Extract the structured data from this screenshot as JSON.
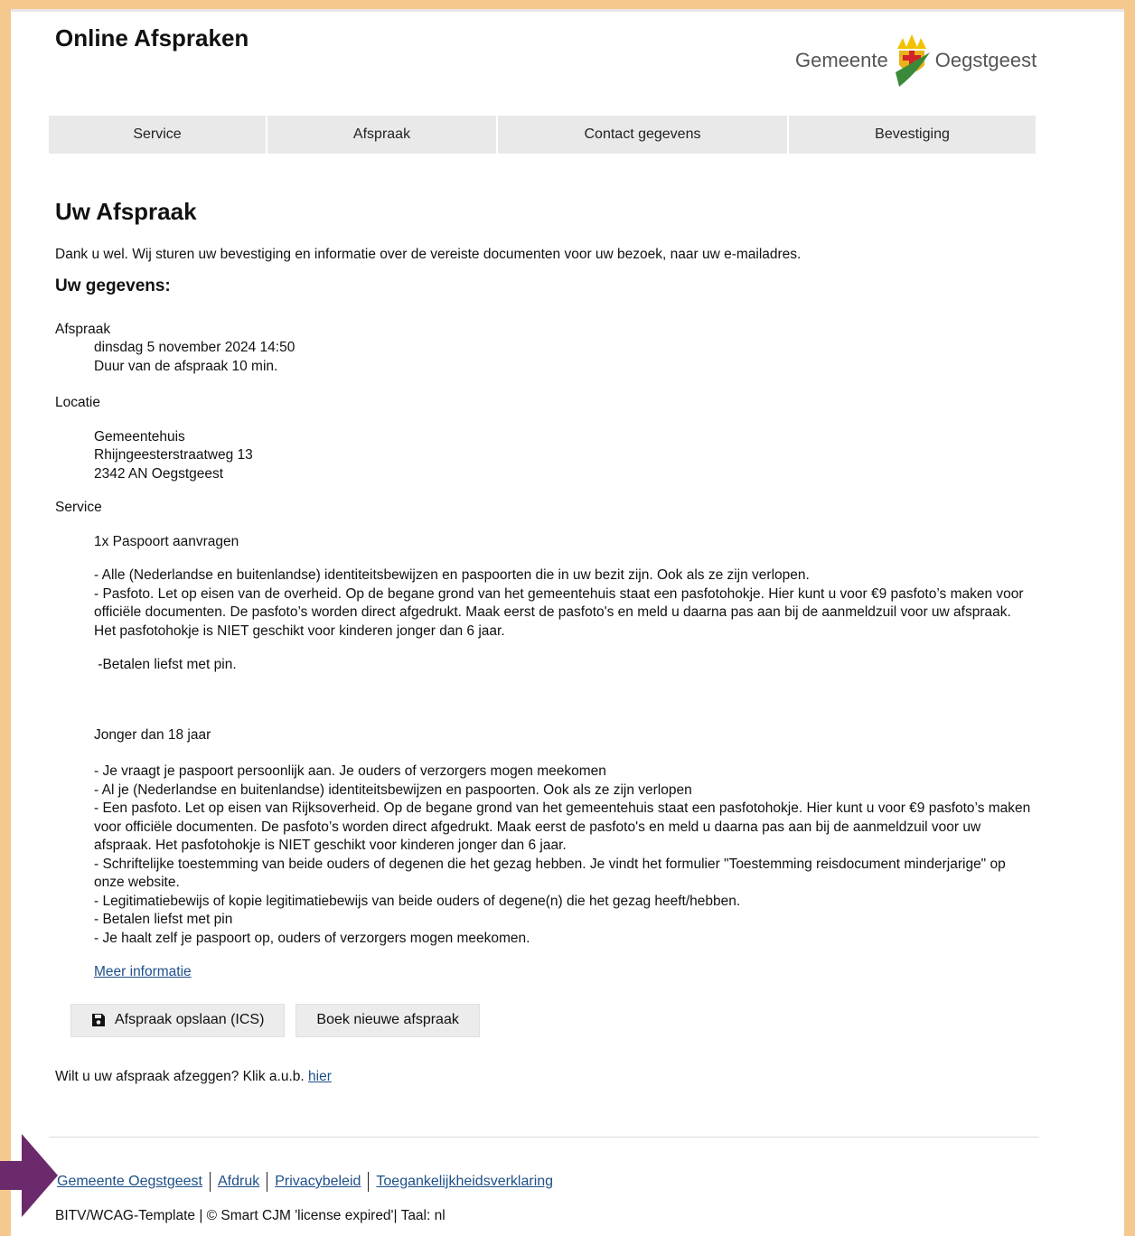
{
  "header": {
    "title": "Online Afspraken",
    "logo_word_left": "Gemeente",
    "logo_word_right": "Oegstgeest"
  },
  "steps": [
    "Service",
    "Afspraak",
    "Contact gegevens",
    "Bevestiging"
  ],
  "main": {
    "heading": "Uw Afspraak",
    "intro": "Dank u wel. Wij sturen uw bevestiging en informatie over de vereiste documenten voor uw bezoek, naar uw e-mailadres.",
    "subheading": "Uw gegevens:",
    "appointment_label": "Afspraak",
    "appointment_date": "dinsdag 5 november 2024 14:50",
    "appointment_duration": "Duur van de afspraak 10 min.",
    "location_label": "Locatie",
    "location_name": "Gemeentehuis",
    "location_street": "Rhijngeesterstraatweg 13",
    "location_city": "2342 AN Oegstgeest",
    "service_label": "Service",
    "service_name": "1x Paspoort aanvragen",
    "service_requirements": "- Alle (Nederlandse en buitenlandse) identiteitsbewijzen en paspoorten die in uw bezit zijn. Ook als ze zijn verlopen.\n- Pasfoto. Let op eisen van de overheid. Op de begane grond van het gemeentehuis staat een pasfotohokje. Hier kunt u voor €9 pasfoto’s maken voor officiële documenten. De pasfoto’s worden direct afgedrukt. Maak eerst de  pasfoto's en meld u daarna pas aan bij de aanmeldzuil voor uw afspraak. Het pasfotohokje is NIET geschikt voor kinderen jonger dan 6 jaar.",
    "payment_note": " -Betalen liefst met pin.",
    "minor_heading": "Jonger dan 18 jaar",
    "minor_requirements": "- Je vraagt je paspoort persoonlijk aan. Je ouders of verzorgers mogen meekomen\n- Al je (Nederlandse en buitenlandse) identiteitsbewijzen en paspoorten. Ook als ze zijn verlopen\n- Een pasfoto. Let op eisen van Rijksoverheid. Op de begane grond van het gemeentehuis staat een pasfotohokje. Hier kunt u voor €9 pasfoto’s maken voor officiële documenten. De pasfoto’s worden direct afgedrukt. Maak eerst de pasfoto's en meld u daarna pas aan bij de aanmeldzuil voor uw afspraak. Het pasfotohokje is NIET geschikt voor kinderen jonger dan 6 jaar.\n- Schriftelijke toestemming van beide ouders of degenen die het gezag hebben. Je vindt het formulier \"Toestemming reisdocument minderjarige\" op onze website.\n- Legitimatiebewijs of kopie legitimatiebewijs van beide ouders of degene(n) die het gezag heeft/hebben.\n- Betalen liefst met pin\n- Je haalt zelf je paspoort op, ouders of verzorgers mogen meekomen.",
    "more_info_link": "Meer informatie",
    "save_button": "Afspraak opslaan (ICS)",
    "new_button": "Boek nieuwe afspraak",
    "cancel_text": "Wilt u uw afspraak afzeggen? Klik a.u.b.",
    "cancel_link": "hier"
  },
  "footer": {
    "links": [
      "Gemeente Oegstgeest",
      "Afdruk",
      "Privacybeleid",
      "Toegankelijkheidsverklaring"
    ],
    "meta": "BITV/WCAG-Template | © Smart CJM 'license expired'| Taal: nl"
  },
  "icons": {
    "save": "floppy-disk-icon",
    "arrow": "arrow-right-icon"
  },
  "colors": {
    "frame": "#f5c98e",
    "link": "#1d4f8a",
    "step_bg": "#e9e9e9",
    "arrow": "#6b2a6b"
  }
}
